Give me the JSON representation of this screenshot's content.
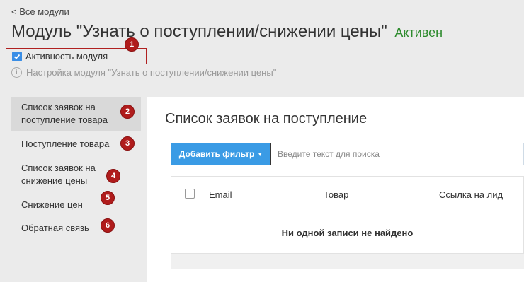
{
  "header": {
    "back_link": "< Все модули",
    "title": "Модуль \"Узнать о поступлении/снижении цены\"",
    "status": "Активен",
    "status_color": "#2e8b2e",
    "activity_label": "Активность модуля",
    "activity_checked": true,
    "settings_text": "Настройка модуля \"Узнать о поступлении/снижении цены\""
  },
  "badges": [
    "1",
    "2",
    "3",
    "4",
    "5",
    "6"
  ],
  "sidebar": {
    "items": [
      {
        "label": "Список заявок на поступление товара",
        "active": true
      },
      {
        "label": "Поступление товара",
        "active": false
      },
      {
        "label": "Список заявок на снижение цены",
        "active": false
      },
      {
        "label": "Снижение цен",
        "active": false
      },
      {
        "label": "Обратная связь",
        "active": false
      }
    ]
  },
  "main": {
    "title": "Список заявок на поступление",
    "filter_button": "Добавить фильтр",
    "search_placeholder": "Введите текст для поиска",
    "columns": [
      "Email",
      "Товар",
      "Ссылка на лид"
    ],
    "empty_text": "Ни одной записи не найдено"
  },
  "colors": {
    "accent": "#3a9be5",
    "badge": "#b01c1c"
  }
}
